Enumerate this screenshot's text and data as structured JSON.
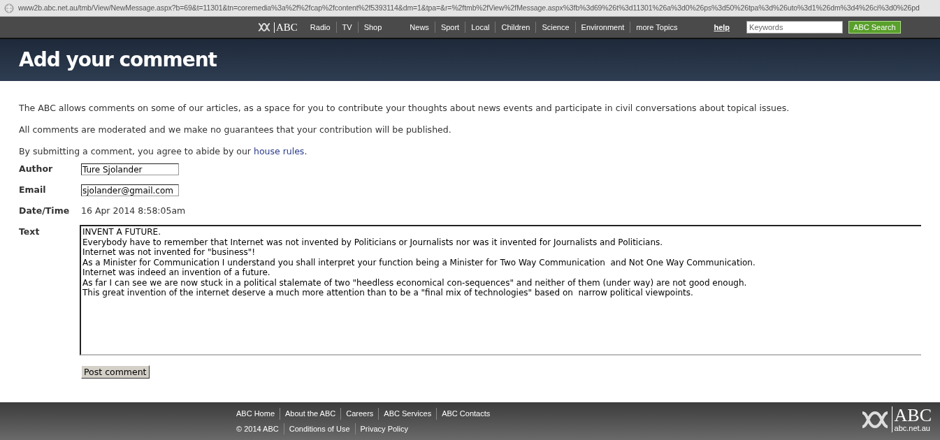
{
  "browser": {
    "url": "www2b.abc.net.au/tmb/View/NewMessage.aspx?b=69&t=11301&tn=coremedia%3a%2f%2fcap%2fcontent%2f5393114&dm=1&tpa=&r=%2ftmb%2fView%2fMessage.aspx%3fb%3d69%26t%3d11301%26a%3d0%26ps%3d50%26tpa%3d%26uto%3d1%26dm%3d4%26ci%3d0%26pd"
  },
  "nav": {
    "logo": "ABC",
    "groups": [
      [
        "Radio",
        "TV",
        "Shop"
      ],
      [
        "News",
        "Sport",
        "Local",
        "Children",
        "Science",
        "Environment",
        "more Topics"
      ]
    ],
    "help": "help",
    "search_placeholder": "Keywords",
    "search_button": "ABC Search"
  },
  "page_title": "Add your comment",
  "intro": [
    "The ABC allows comments on some of our articles, as a space for you to contribute your thoughts about news events and participate in civil conversations about topical issues.",
    "All comments are moderated and we make no guarantees that your contribution will be published."
  ],
  "rules_text": "By submitting a comment, you agree to abide by our",
  "rules_link": "house rules",
  "rules_end": ".",
  "form": [
    {
      "kind": "input",
      "label": "Author",
      "value": "Ture Sjolander"
    },
    {
      "kind": "input",
      "label": "Email",
      "value": "sjolander@gmail.com"
    },
    {
      "kind": "text",
      "label": "Date/Time",
      "value": "16 Apr 2014 8:58:05am"
    },
    {
      "kind": "textarea",
      "label": "Text",
      "lines": [
        "INVENT A FUTURE.",
        "Everybody have to remember that Internet was not invented by Politicians or Journalists nor was it invented for Journalists and Politicians.",
        "Internet was not invented for \"business\"!",
        "As a Minister for Communication I understand you shall interpret your function being a Minister for Two Way Communication  and Not One Way Communication.",
        "Internet was indeed an invention of a future.",
        "As far I can see we are now stuck in a political stalemate of two \"heedless economical con-sequences\" and neither of them (under way) are not good enough.",
        "This great invention of the internet deserve a much more attention than to be a \"final mix of technologies\" based on  narrow political viewpoints."
      ]
    }
  ],
  "submit": "Post comment",
  "footer": {
    "rows": [
      [
        "ABC Home",
        "About the ABC",
        "Careers",
        "ABC Services",
        "ABC Contacts"
      ],
      [
        "© 2014 ABC",
        "Conditions of Use",
        "Privacy Policy"
      ]
    ],
    "logo": "ABC",
    "domain": "abc.net.au"
  }
}
